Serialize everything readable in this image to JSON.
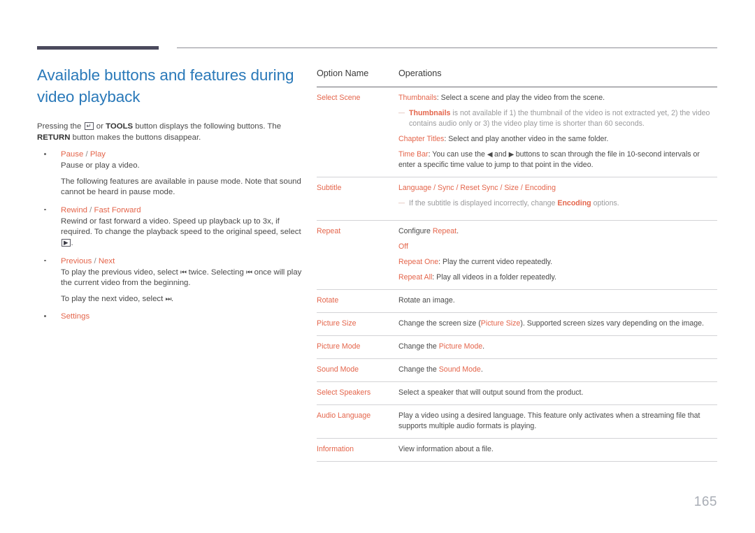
{
  "page": {
    "number": "165",
    "accent_orange": "#e4654b",
    "accent_blue": "#2a79b9",
    "rule_dark": "#4b4a5d"
  },
  "left": {
    "title": "Available buttons and features during video playback",
    "intro_before_icon": "Pressing the",
    "enter_icon": "enter-key-icon",
    "enter_icon_glyph": "↵",
    "intro_mid": "or",
    "intro_tools": "TOOLS",
    "intro_after": "button displays the following buttons. The",
    "intro_return": "RETURN",
    "intro_end": "button makes the buttons disappear.",
    "bullets": [
      {
        "head_a": "Pause",
        "head_sep": " / ",
        "head_b": "Play",
        "body": [
          "Pause or play a video.",
          "The following features are available in pause mode. Note that sound cannot be heard in pause mode."
        ]
      },
      {
        "head_a": "Rewind",
        "head_sep": " / ",
        "head_b": "Fast Forward",
        "body_before": "Rewind or fast forward a video. Speed up playback up to 3x, if required. To change the playback speed to the original speed, select",
        "play_icon": "play-button-icon",
        "play_icon_glyph": "▶",
        "body_after": "."
      },
      {
        "head_a": "Previous",
        "head_sep": " / ",
        "head_b": "Next",
        "line1_a": "To play the previous video, select",
        "prev_glyph": "⏮",
        "line1_b": "twice. Selecting",
        "line1_c": "once will play the current video from the beginning.",
        "line2_a": "To play the next video, select",
        "next_glyph": "⏭",
        "line2_b": "."
      },
      {
        "head_a": "Settings",
        "head_sep": "",
        "head_b": ""
      }
    ]
  },
  "table": {
    "headers": [
      "Option Name",
      "Operations"
    ],
    "rows": [
      {
        "name": "Select Scene",
        "lines": [
          {
            "type": "hl-lead",
            "hl": "Thumbnails",
            "text": ": Select a scene and play the video from the scene."
          },
          {
            "type": "note",
            "hl": "Thumbnails",
            "text": " is not available if 1) the thumbnail of the video is not extracted yet, 2) the video contains audio only or 3) the video play time is shorter than 60 seconds."
          },
          {
            "type": "hl-lead",
            "hl": "Chapter Titles",
            "text": ": Select and play another video in the same folder."
          },
          {
            "type": "timebar",
            "hl": "Time Bar",
            "text_a": ": You can use the ",
            "glyph_a": "◀",
            "text_b": " and ",
            "glyph_b": "▶",
            "text_c": " buttons to scan through the file in 10-second intervals or enter a specific time value to jump to that point in the video."
          }
        ]
      },
      {
        "name": "Subtitle",
        "lines": [
          {
            "type": "all-hl",
            "text": "Language / Sync / Reset Sync / Size / Encoding"
          },
          {
            "type": "note-mid",
            "text_a": "If the subtitle is displayed incorrectly, change ",
            "hl": "Encoding",
            "text_b": " options."
          }
        ]
      },
      {
        "name": "Repeat",
        "lines": [
          {
            "type": "mid-hl",
            "text_a": "Configure ",
            "hl": "Repeat",
            "text_b": "."
          },
          {
            "type": "all-hl",
            "text": "Off"
          },
          {
            "type": "hl-lead",
            "hl": "Repeat One",
            "text": ": Play the current video repeatedly."
          },
          {
            "type": "hl-lead",
            "hl": "Repeat All",
            "text": ": Play all videos in a folder repeatedly."
          }
        ]
      },
      {
        "name": "Rotate",
        "lines": [
          {
            "type": "plain",
            "text": "Rotate an image."
          }
        ]
      },
      {
        "name": "Picture Size",
        "lines": [
          {
            "type": "mid-hl-wrap",
            "text_a": "Change the screen size (",
            "hl": "Picture Size",
            "text_b": "). Supported screen sizes vary depending on the image."
          }
        ]
      },
      {
        "name": "Picture Mode",
        "lines": [
          {
            "type": "mid-hl",
            "text_a": "Change the ",
            "hl": "Picture Mode",
            "text_b": "."
          }
        ]
      },
      {
        "name": "Sound Mode",
        "lines": [
          {
            "type": "mid-hl",
            "text_a": "Change the ",
            "hl": "Sound Mode",
            "text_b": "."
          }
        ]
      },
      {
        "name": "Select Speakers",
        "lines": [
          {
            "type": "plain",
            "text": "Select a speaker that will output sound from the product."
          }
        ]
      },
      {
        "name": "Audio Language",
        "lines": [
          {
            "type": "plain",
            "text": "Play a video using a desired language. This feature only activates when a streaming file that supports multiple audio formats is playing."
          }
        ]
      },
      {
        "name": "Information",
        "lines": [
          {
            "type": "plain",
            "text": "View information about a file."
          }
        ]
      }
    ]
  }
}
